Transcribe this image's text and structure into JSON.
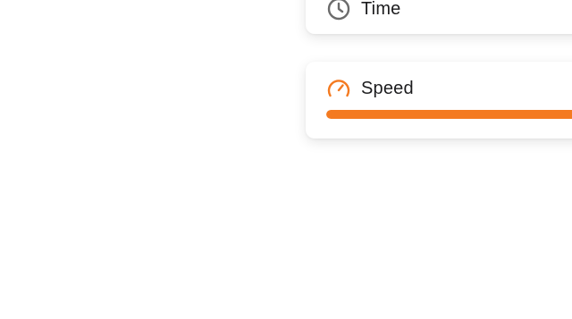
{
  "cards": {
    "time": {
      "label": "Time",
      "icon": "clock-icon",
      "icon_color": "#6b6b6b"
    },
    "speed": {
      "label": "Speed",
      "icon": "speedometer-icon",
      "icon_color": "#f47a20",
      "progress_fraction": 1.0,
      "progress_color": "#f47a20"
    }
  }
}
